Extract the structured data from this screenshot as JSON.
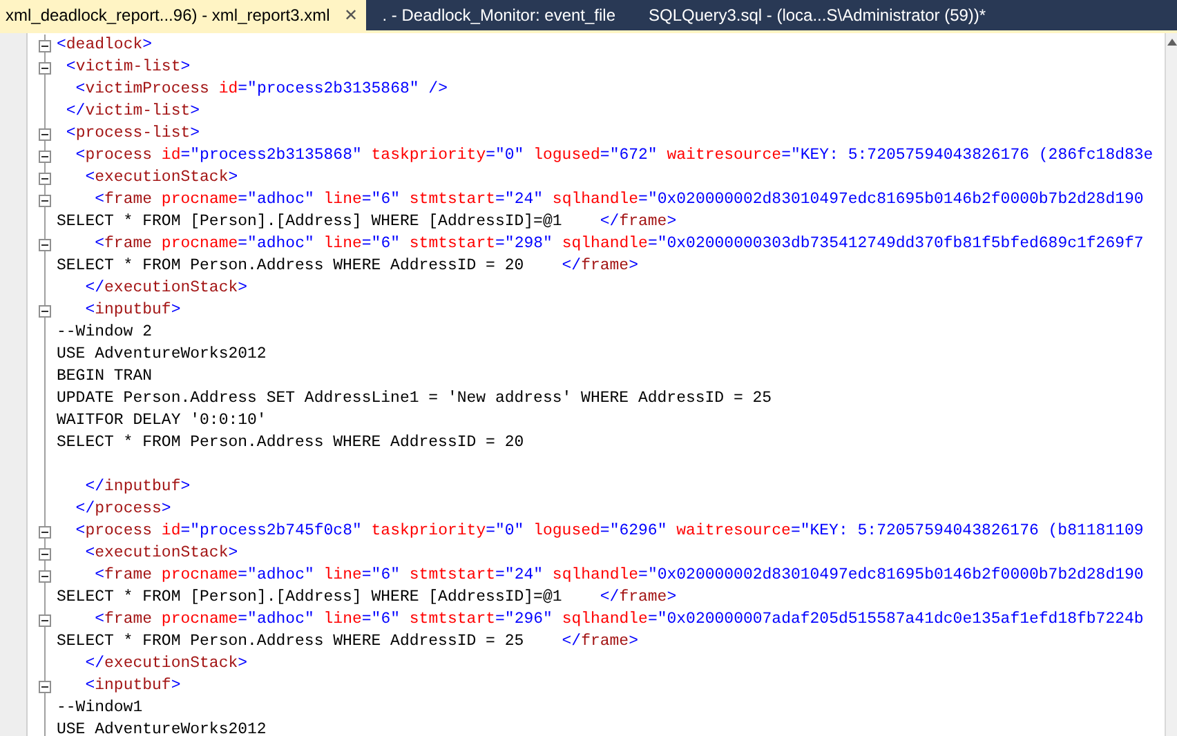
{
  "tabs": [
    {
      "label": "xml_deadlock_report...96) - xml_report3.xml",
      "selected": true,
      "close": "✕"
    },
    {
      "label": ". - Deadlock_Monitor: event_file",
      "selected": false
    },
    {
      "label": "SQLQuery3.sql - (loca...S\\Administrator (59))*",
      "selected": false
    }
  ],
  "editor": {
    "lines": [
      {
        "foldable": true,
        "segments": [
          {
            "kind": "bracket",
            "text": "<"
          },
          {
            "kind": "tag",
            "text": "deadlock"
          },
          {
            "kind": "bracket",
            "text": ">"
          }
        ]
      },
      {
        "foldable": true,
        "segments": [
          {
            "kind": "bracket",
            "text": " <"
          },
          {
            "kind": "tag",
            "text": "victim-list"
          },
          {
            "kind": "bracket",
            "text": ">"
          }
        ]
      },
      {
        "foldable": false,
        "segments": [
          {
            "kind": "bracket",
            "text": "  <"
          },
          {
            "kind": "tag",
            "text": "victimProcess"
          },
          {
            "kind": "attr",
            "text": " id"
          },
          {
            "kind": "value",
            "text": "=\"process2b3135868\""
          },
          {
            "kind": "bracket",
            "text": " />"
          }
        ]
      },
      {
        "foldable": false,
        "segments": [
          {
            "kind": "bracket",
            "text": " </"
          },
          {
            "kind": "tag",
            "text": "victim-list"
          },
          {
            "kind": "bracket",
            "text": ">"
          }
        ]
      },
      {
        "foldable": true,
        "segments": [
          {
            "kind": "bracket",
            "text": " <"
          },
          {
            "kind": "tag",
            "text": "process-list"
          },
          {
            "kind": "bracket",
            "text": ">"
          }
        ]
      },
      {
        "foldable": true,
        "segments": [
          {
            "kind": "bracket",
            "text": "  <"
          },
          {
            "kind": "tag",
            "text": "process"
          },
          {
            "kind": "attr",
            "text": " id"
          },
          {
            "kind": "value",
            "text": "=\"process2b3135868\""
          },
          {
            "kind": "attr",
            "text": " taskpriority"
          },
          {
            "kind": "value",
            "text": "=\"0\""
          },
          {
            "kind": "attr",
            "text": " logused"
          },
          {
            "kind": "value",
            "text": "=\"672\""
          },
          {
            "kind": "attr",
            "text": " waitresource"
          },
          {
            "kind": "value",
            "text": "=\"KEY: 5:72057594043826176 (286fc18d83e"
          }
        ]
      },
      {
        "foldable": true,
        "segments": [
          {
            "kind": "bracket",
            "text": "   <"
          },
          {
            "kind": "tag",
            "text": "executionStack"
          },
          {
            "kind": "bracket",
            "text": ">"
          }
        ]
      },
      {
        "foldable": true,
        "segments": [
          {
            "kind": "bracket",
            "text": "    <"
          },
          {
            "kind": "tag",
            "text": "frame"
          },
          {
            "kind": "attr",
            "text": " procname"
          },
          {
            "kind": "value",
            "text": "=\"adhoc\""
          },
          {
            "kind": "attr",
            "text": " line"
          },
          {
            "kind": "value",
            "text": "=\"6\""
          },
          {
            "kind": "attr",
            "text": " stmtstart"
          },
          {
            "kind": "value",
            "text": "=\"24\""
          },
          {
            "kind": "attr",
            "text": " sqlhandle"
          },
          {
            "kind": "value",
            "text": "=\"0x020000002d83010497edc81695b0146b2f0000b7b2d28d190"
          }
        ]
      },
      {
        "foldable": false,
        "segments": [
          {
            "kind": "text",
            "text": "SELECT * FROM [Person].[Address] WHERE [AddressID]=@1    "
          },
          {
            "kind": "bracket",
            "text": "</"
          },
          {
            "kind": "tag",
            "text": "frame"
          },
          {
            "kind": "bracket",
            "text": ">"
          }
        ]
      },
      {
        "foldable": true,
        "segments": [
          {
            "kind": "bracket",
            "text": "    <"
          },
          {
            "kind": "tag",
            "text": "frame"
          },
          {
            "kind": "attr",
            "text": " procname"
          },
          {
            "kind": "value",
            "text": "=\"adhoc\""
          },
          {
            "kind": "attr",
            "text": " line"
          },
          {
            "kind": "value",
            "text": "=\"6\""
          },
          {
            "kind": "attr",
            "text": " stmtstart"
          },
          {
            "kind": "value",
            "text": "=\"298\""
          },
          {
            "kind": "attr",
            "text": " sqlhandle"
          },
          {
            "kind": "value",
            "text": "=\"0x02000000303db735412749dd370fb81f5bfed689c1f269f7"
          }
        ]
      },
      {
        "foldable": false,
        "segments": [
          {
            "kind": "text",
            "text": "SELECT * FROM Person.Address WHERE AddressID = 20    "
          },
          {
            "kind": "bracket",
            "text": "</"
          },
          {
            "kind": "tag",
            "text": "frame"
          },
          {
            "kind": "bracket",
            "text": ">"
          }
        ]
      },
      {
        "foldable": false,
        "segments": [
          {
            "kind": "bracket",
            "text": "   </"
          },
          {
            "kind": "tag",
            "text": "executionStack"
          },
          {
            "kind": "bracket",
            "text": ">"
          }
        ]
      },
      {
        "foldable": true,
        "segments": [
          {
            "kind": "bracket",
            "text": "   <"
          },
          {
            "kind": "tag",
            "text": "inputbuf"
          },
          {
            "kind": "bracket",
            "text": ">"
          }
        ]
      },
      {
        "foldable": false,
        "segments": [
          {
            "kind": "text",
            "text": "--Window 2"
          }
        ]
      },
      {
        "foldable": false,
        "segments": [
          {
            "kind": "text",
            "text": "USE AdventureWorks2012"
          }
        ]
      },
      {
        "foldable": false,
        "segments": [
          {
            "kind": "text",
            "text": "BEGIN TRAN"
          }
        ]
      },
      {
        "foldable": false,
        "segments": [
          {
            "kind": "text",
            "text": "UPDATE Person.Address SET AddressLine1 = 'New address' WHERE AddressID = 25"
          }
        ]
      },
      {
        "foldable": false,
        "segments": [
          {
            "kind": "text",
            "text": "WAITFOR DELAY '0:0:10'"
          }
        ]
      },
      {
        "foldable": false,
        "segments": [
          {
            "kind": "text",
            "text": "SELECT * FROM Person.Address WHERE AddressID = 20"
          }
        ]
      },
      {
        "foldable": false
      },
      {
        "foldable": false,
        "segments": [
          {
            "kind": "bracket",
            "text": "   </"
          },
          {
            "kind": "tag",
            "text": "inputbuf"
          },
          {
            "kind": "bracket",
            "text": ">"
          }
        ]
      },
      {
        "foldable": false,
        "segments": [
          {
            "kind": "bracket",
            "text": "  </"
          },
          {
            "kind": "tag",
            "text": "process"
          },
          {
            "kind": "bracket",
            "text": ">"
          }
        ]
      },
      {
        "foldable": true,
        "segments": [
          {
            "kind": "bracket",
            "text": "  <"
          },
          {
            "kind": "tag",
            "text": "process"
          },
          {
            "kind": "attr",
            "text": " id"
          },
          {
            "kind": "value",
            "text": "=\"process2b745f0c8\""
          },
          {
            "kind": "attr",
            "text": " taskpriority"
          },
          {
            "kind": "value",
            "text": "=\"0\""
          },
          {
            "kind": "attr",
            "text": " logused"
          },
          {
            "kind": "value",
            "text": "=\"6296\""
          },
          {
            "kind": "attr",
            "text": " waitresource"
          },
          {
            "kind": "value",
            "text": "=\"KEY: 5:72057594043826176 (b81181109"
          }
        ]
      },
      {
        "foldable": true,
        "segments": [
          {
            "kind": "bracket",
            "text": "   <"
          },
          {
            "kind": "tag",
            "text": "executionStack"
          },
          {
            "kind": "bracket",
            "text": ">"
          }
        ]
      },
      {
        "foldable": true,
        "segments": [
          {
            "kind": "bracket",
            "text": "    <"
          },
          {
            "kind": "tag",
            "text": "frame"
          },
          {
            "kind": "attr",
            "text": " procname"
          },
          {
            "kind": "value",
            "text": "=\"adhoc\""
          },
          {
            "kind": "attr",
            "text": " line"
          },
          {
            "kind": "value",
            "text": "=\"6\""
          },
          {
            "kind": "attr",
            "text": " stmtstart"
          },
          {
            "kind": "value",
            "text": "=\"24\""
          },
          {
            "kind": "attr",
            "text": " sqlhandle"
          },
          {
            "kind": "value",
            "text": "=\"0x020000002d83010497edc81695b0146b2f0000b7b2d28d190"
          }
        ]
      },
      {
        "foldable": false,
        "segments": [
          {
            "kind": "text",
            "text": "SELECT * FROM [Person].[Address] WHERE [AddressID]=@1    "
          },
          {
            "kind": "bracket",
            "text": "</"
          },
          {
            "kind": "tag",
            "text": "frame"
          },
          {
            "kind": "bracket",
            "text": ">"
          }
        ]
      },
      {
        "foldable": true,
        "segments": [
          {
            "kind": "bracket",
            "text": "    <"
          },
          {
            "kind": "tag",
            "text": "frame"
          },
          {
            "kind": "attr",
            "text": " procname"
          },
          {
            "kind": "value",
            "text": "=\"adhoc\""
          },
          {
            "kind": "attr",
            "text": " line"
          },
          {
            "kind": "value",
            "text": "=\"6\""
          },
          {
            "kind": "attr",
            "text": " stmtstart"
          },
          {
            "kind": "value",
            "text": "=\"296\""
          },
          {
            "kind": "attr",
            "text": " sqlhandle"
          },
          {
            "kind": "value",
            "text": "=\"0x020000007adaf205d515587a41dc0e135af1efd18fb7224b"
          }
        ]
      },
      {
        "foldable": false,
        "segments": [
          {
            "kind": "text",
            "text": "SELECT * FROM Person.Address WHERE AddressID = 25    "
          },
          {
            "kind": "bracket",
            "text": "</"
          },
          {
            "kind": "tag",
            "text": "frame"
          },
          {
            "kind": "bracket",
            "text": ">"
          }
        ]
      },
      {
        "foldable": false,
        "segments": [
          {
            "kind": "bracket",
            "text": "   </"
          },
          {
            "kind": "tag",
            "text": "executionStack"
          },
          {
            "kind": "bracket",
            "text": ">"
          }
        ]
      },
      {
        "foldable": true,
        "segments": [
          {
            "kind": "bracket",
            "text": "   <"
          },
          {
            "kind": "tag",
            "text": "inputbuf"
          },
          {
            "kind": "bracket",
            "text": ">"
          }
        ]
      },
      {
        "foldable": false,
        "segments": [
          {
            "kind": "text",
            "text": "--Window1"
          }
        ]
      },
      {
        "foldable": false,
        "segments": [
          {
            "kind": "text",
            "text": "USE AdventureWorks2012"
          }
        ]
      }
    ]
  }
}
